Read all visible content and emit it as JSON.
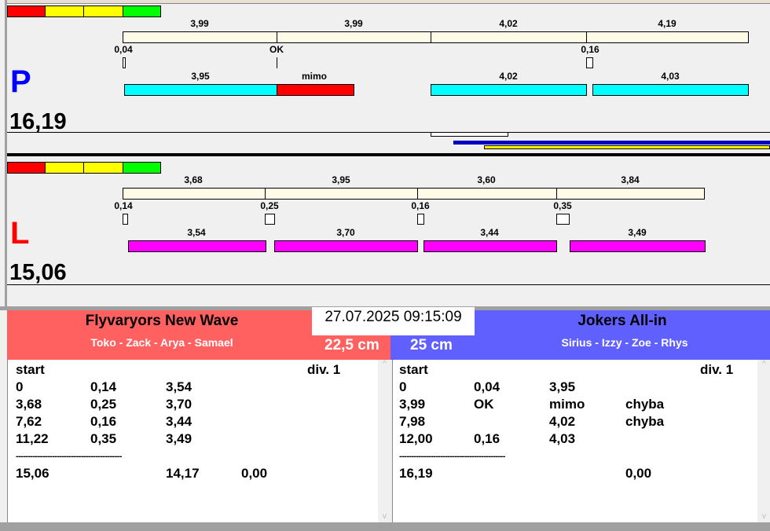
{
  "lane_p": {
    "letter": "P",
    "total": "16,19",
    "segment_labels": [
      "3,99",
      "3,99",
      "4,02",
      "4,19"
    ],
    "gap_labels": [
      "0,04",
      "OK",
      "0,16"
    ],
    "run_labels": [
      "3,95",
      "mimo",
      "4,02",
      "4,03"
    ]
  },
  "lane_l": {
    "letter": "L",
    "total": "15,06",
    "segment_labels": [
      "3,68",
      "3,95",
      "3,60",
      "3,84"
    ],
    "gap_labels": [
      "0,14",
      "0,25",
      "0,16",
      "0,35"
    ],
    "run_labels": [
      "3,54",
      "3,70",
      "3,44",
      "3,49"
    ]
  },
  "colors": {
    "p_letter": "#0000ff",
    "l_letter": "#ff0000",
    "left_team": "#ff6060",
    "right_team": "#6060ff"
  },
  "datetime": "27.07.2025 09:15:09",
  "left_team": {
    "name": "Flyvaryors New Wave",
    "members": "Toko - Zack - Arya - Samael",
    "distance": "22,5 cm",
    "list": {
      "header": [
        "start",
        "div. 1"
      ],
      "rows": [
        [
          "0",
          "0,14",
          "3,54",
          ""
        ],
        [
          "3,68",
          "0,25",
          "3,70",
          ""
        ],
        [
          "7,62",
          "0,16",
          "3,44",
          ""
        ],
        [
          "11,22",
          "0,35",
          "3,49",
          ""
        ]
      ],
      "separator": "--------------------------------------------",
      "total": [
        "15,06",
        "",
        "14,17",
        "0,00"
      ]
    }
  },
  "right_team": {
    "name": "Jokers All-in",
    "members": "Sirius - Izzy - Zoe - Rhys",
    "distance": "25 cm",
    "list": {
      "header": [
        "start",
        "div. 1"
      ],
      "rows": [
        [
          "0",
          "0,04",
          "3,95",
          ""
        ],
        [
          "3,99",
          "OK",
          "mimo",
          "chyba"
        ],
        [
          "7,98",
          "",
          "4,02",
          "chyba"
        ],
        [
          "12,00",
          "0,16",
          "4,03",
          ""
        ]
      ],
      "separator": "--------------------------------------------",
      "total": [
        "16,19",
        "",
        "",
        "0,00"
      ]
    }
  }
}
